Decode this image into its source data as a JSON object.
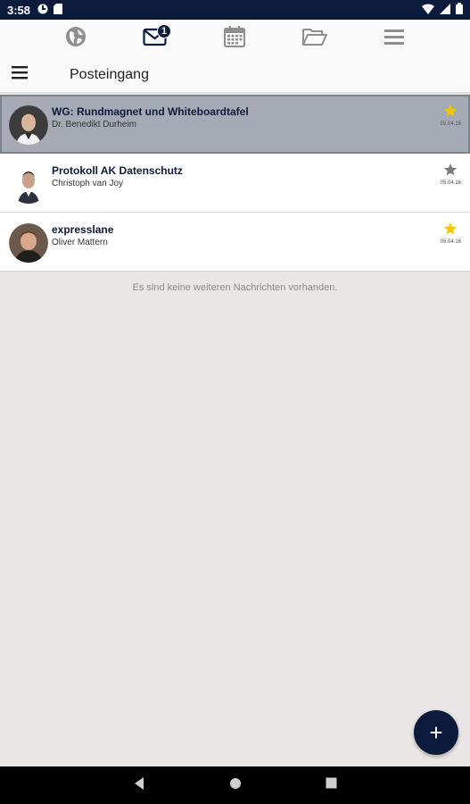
{
  "status_bar": {
    "time": "3:58"
  },
  "top_nav": {
    "items": [
      {
        "name": "globe-icon"
      },
      {
        "name": "mail-icon",
        "badge": "1"
      },
      {
        "name": "calendar-icon"
      },
      {
        "name": "folder-icon"
      },
      {
        "name": "menu-icon"
      }
    ]
  },
  "header": {
    "title": "Posteingang"
  },
  "messages": [
    {
      "subject": "WG: Rundmagnet und Whiteboardtafel",
      "sender": "Dr. Benedikt Durheim",
      "date": "05.04.16",
      "starred": true,
      "selected": true
    },
    {
      "subject": "Protokoll AK Datenschutz",
      "sender": "Christoph van Joy",
      "date": "05.04.16",
      "starred": false,
      "selected": false
    },
    {
      "subject": "expresslane",
      "sender": "Oliver Mattern",
      "date": "05.04.16",
      "starred": true,
      "selected": false
    }
  ],
  "empty_note": "Es sind keine weiteren Nachrichten vorhanden.",
  "fab": {
    "label": "+"
  },
  "colors": {
    "primary": "#0c1a3c",
    "star_active": "#f5c400",
    "star_inactive": "#7a7a7a",
    "selected_bg": "#a5aab5",
    "background": "#e9e6e5"
  }
}
